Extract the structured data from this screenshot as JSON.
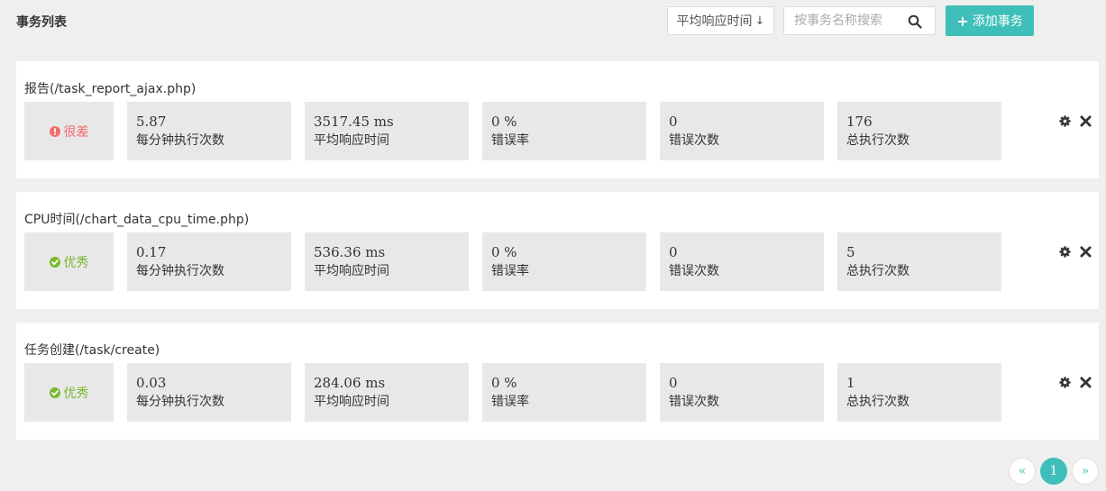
{
  "header": {
    "title": "事务列表",
    "sort_label": "平均响应时间",
    "sort_arrow": "↓",
    "search_placeholder": "按事务名称搜索",
    "add_label": "添加事务",
    "add_icon": "+"
  },
  "colors": {
    "accent": "#3fbfba",
    "bad": "#f26b6b",
    "good": "#7ab82e"
  },
  "transactions": [
    {
      "title": "报告(/task_report_ajax.php)",
      "status": "很差",
      "status_type": "bad",
      "status_icon": "exclamation-circle-icon",
      "metrics": [
        {
          "value": "5.87",
          "label": "每分钟执行次数"
        },
        {
          "value": "3517.45 ms",
          "label": "平均响应时间"
        },
        {
          "value": "0 %",
          "label": "错误率"
        },
        {
          "value": "0",
          "label": "错误次数"
        },
        {
          "value": "176",
          "label": "总执行次数"
        }
      ]
    },
    {
      "title": "CPU时间(/chart_data_cpu_time.php)",
      "status": "优秀",
      "status_type": "good",
      "status_icon": "check-circle-icon",
      "metrics": [
        {
          "value": "0.17",
          "label": "每分钟执行次数"
        },
        {
          "value": "536.36 ms",
          "label": "平均响应时间"
        },
        {
          "value": "0 %",
          "label": "错误率"
        },
        {
          "value": "0",
          "label": "错误次数"
        },
        {
          "value": "5",
          "label": "总执行次数"
        }
      ]
    },
    {
      "title": "任务创建(/task/create)",
      "status": "优秀",
      "status_type": "good",
      "status_icon": "check-circle-icon",
      "metrics": [
        {
          "value": "0.03",
          "label": "每分钟执行次数"
        },
        {
          "value": "284.06 ms",
          "label": "平均响应时间"
        },
        {
          "value": "0 %",
          "label": "错误率"
        },
        {
          "value": "0",
          "label": "错误次数"
        },
        {
          "value": "1",
          "label": "总执行次数"
        }
      ]
    }
  ],
  "pagination": {
    "prev": "«",
    "current": "1",
    "next": "»"
  }
}
